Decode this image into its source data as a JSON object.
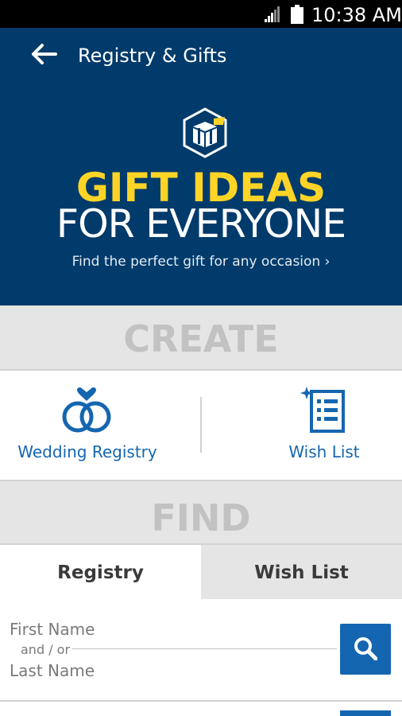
{
  "status_bar": {
    "time": "10:38 AM",
    "icons": [
      "signal-icon",
      "battery-icon"
    ]
  },
  "app_bar": {
    "back_icon": "arrow-left-icon",
    "title": "Registry & Gifts"
  },
  "hero": {
    "icon": "gift-box-icon",
    "headline": "GIFT IDEAS",
    "subhead": "FOR EVERYONE",
    "tagline": "Find the perfect gift for any occasion ›",
    "colors": {
      "background": "#003b6b",
      "headline": "#ffd426"
    }
  },
  "create": {
    "header": "CREATE",
    "items": [
      {
        "label": "Wedding Registry",
        "icon": "wedding-rings-icon"
      },
      {
        "label": "Wish List",
        "icon": "wish-list-icon"
      }
    ]
  },
  "find": {
    "header": "FIND",
    "tabs": [
      {
        "label": "Registry",
        "selected": true
      },
      {
        "label": "Wish List",
        "selected": false
      }
    ],
    "form": {
      "first_name_placeholder": "First Name",
      "separator": "and / or",
      "last_name_placeholder": "Last Name",
      "search_icon": "search-icon"
    }
  },
  "colors": {
    "accent": "#1566b0",
    "section_bg": "#e5e5e5",
    "section_text": "#c2c2c2"
  }
}
